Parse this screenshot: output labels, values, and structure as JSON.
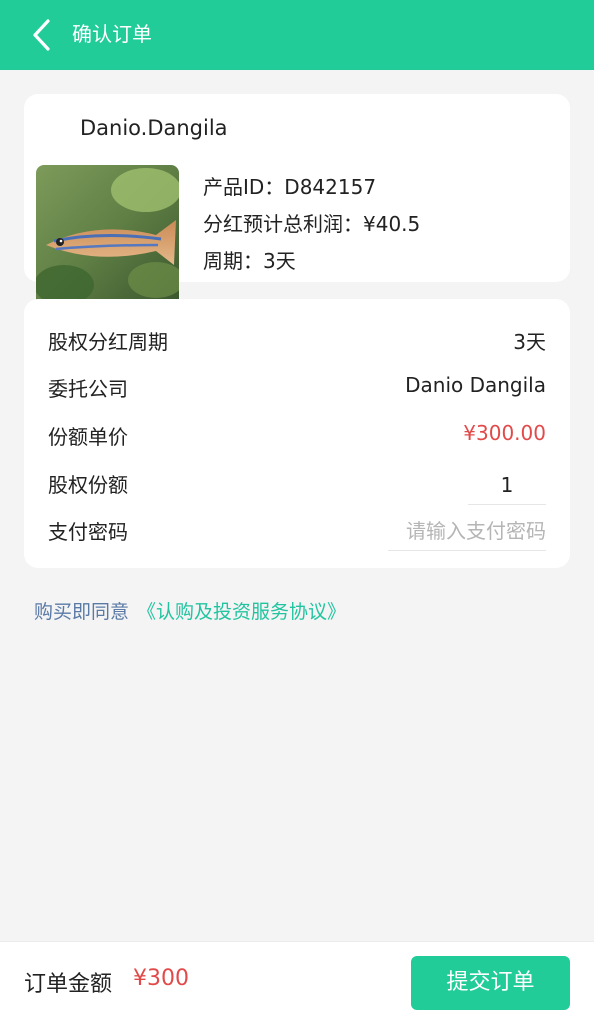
{
  "header": {
    "title": "确认订单",
    "back_icon": "chevron-left-icon"
  },
  "product": {
    "name": "Danio.Dangila",
    "id_line": "产品ID：D842157",
    "profit_line": "分红预计总利润：¥40.5",
    "period_line": "周期：3天",
    "image": "zebrafish-photo"
  },
  "details": {
    "rows": [
      {
        "label": "股权分红周期",
        "value": "3天"
      },
      {
        "label": "委托公司",
        "value": "Danio Dangila"
      },
      {
        "label": "份额单价",
        "value": "¥300.00"
      },
      {
        "label": "股权份额",
        "value": "1"
      },
      {
        "label": "支付密码",
        "placeholder": "请输入支付密码"
      }
    ]
  },
  "agreement": {
    "text": "购买即同意",
    "link": "《认购及投资服务协议》"
  },
  "footer": {
    "label": "订单金额",
    "amount": "¥300",
    "submit": "提交订单"
  },
  "colors": {
    "accent": "#22cc99",
    "price": "#e24a4a",
    "link": "#22c4a0",
    "agree_text": "#5a7aa6"
  }
}
